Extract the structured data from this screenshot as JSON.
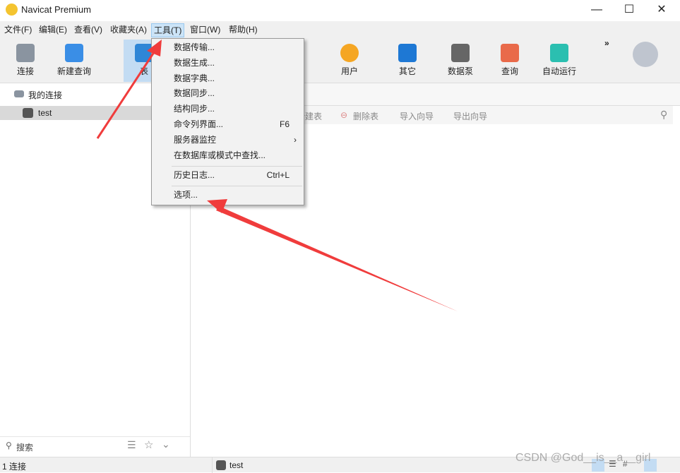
{
  "window": {
    "title": "Navicat Premium",
    "minimize": "—",
    "maximize": "☐",
    "close": "✕"
  },
  "menubar": [
    "文件(F)",
    "编辑(E)",
    "查看(V)",
    "收藏夹(A)",
    "工具(T)",
    "窗口(W)",
    "帮助(H)"
  ],
  "toolbar": {
    "items": [
      {
        "label": "连接",
        "icon": "connection-plug-icon"
      },
      {
        "label": "新建查询",
        "icon": "new-query-icon"
      },
      {
        "label": "表",
        "icon": "table-icon"
      },
      {
        "label": "用户",
        "icon": "user-icon"
      },
      {
        "label": "其它",
        "icon": "tools-icon"
      },
      {
        "label": "数据泵",
        "icon": "data-pump-icon"
      },
      {
        "label": "查询",
        "icon": "query-icon"
      },
      {
        "label": "自动运行",
        "icon": "robot-icon"
      }
    ],
    "more": "»"
  },
  "sidebar": {
    "root": "我的连接",
    "connection": "test",
    "search_placeholder": "搜索"
  },
  "objbar": {
    "new_table": "新建表",
    "delete_table": "删除表",
    "import": "导入向导",
    "export": "导出向导"
  },
  "tools_menu": [
    {
      "label": "数据传输..."
    },
    {
      "label": "数据生成..."
    },
    {
      "label": "数据字典..."
    },
    {
      "label": "数据同步..."
    },
    {
      "label": "结构同步..."
    },
    {
      "label": "命令列界面...",
      "shortcut": "F6"
    },
    {
      "label": "服务器监控",
      "submenu": "›"
    },
    {
      "label": "在数据库或模式中查找..."
    },
    {
      "label": "历史日志...",
      "shortcut": "Ctrl+L"
    },
    {
      "label": "选项..."
    }
  ],
  "statusbar": {
    "connections": "1 连接",
    "current": "test"
  },
  "watermark": "CSDN @God__is__a__girl",
  "colors": {
    "accent": "#cce4f7",
    "arrow": "#f03c3c"
  }
}
